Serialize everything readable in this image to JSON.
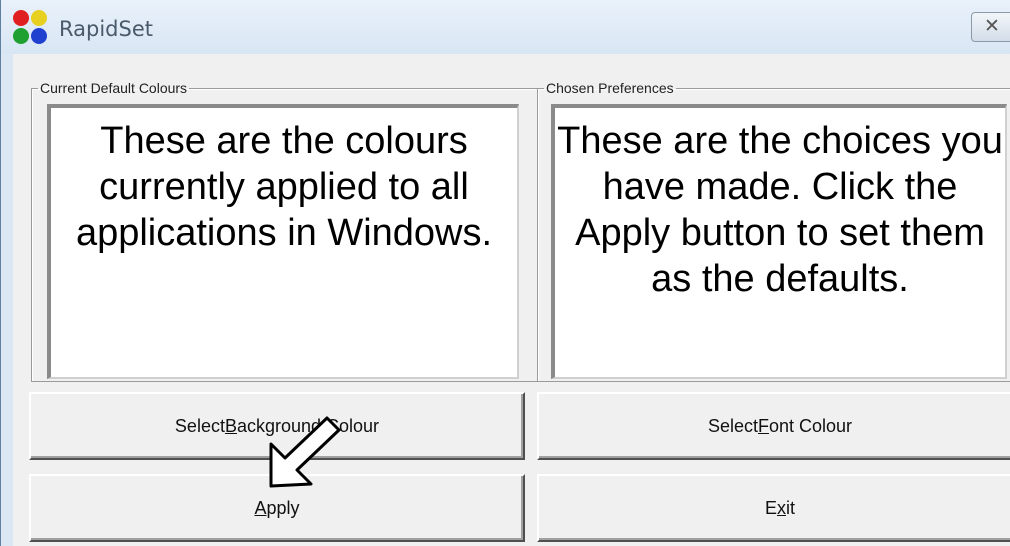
{
  "window": {
    "title": "RapidSet",
    "close_glyph": "✕"
  },
  "groups": {
    "current": {
      "legend": "Current Default Colours",
      "text": "These are the colours currently applied to all applications in Windows."
    },
    "chosen": {
      "legend": "Chosen Preferences",
      "text": "These are the choices you have made.  Click the Apply button to set them as the defaults."
    }
  },
  "buttons": {
    "background": {
      "pre": "Select ",
      "key": "B",
      "post": "ackground Colour"
    },
    "font": {
      "pre": "Select ",
      "key": "F",
      "post": "ont Colour"
    },
    "apply": {
      "pre": "",
      "key": "A",
      "post": "pply"
    },
    "exit": {
      "pre": "E",
      "key": "x",
      "post": "it"
    }
  },
  "icons": {
    "app": "rapidset-app-icon",
    "close": "close-icon",
    "cursor": "mouse-pointer-icon"
  },
  "colors": {
    "titlebar": "#dbe7f3",
    "client": "#f0f0f0",
    "panel": "#ffffff"
  }
}
